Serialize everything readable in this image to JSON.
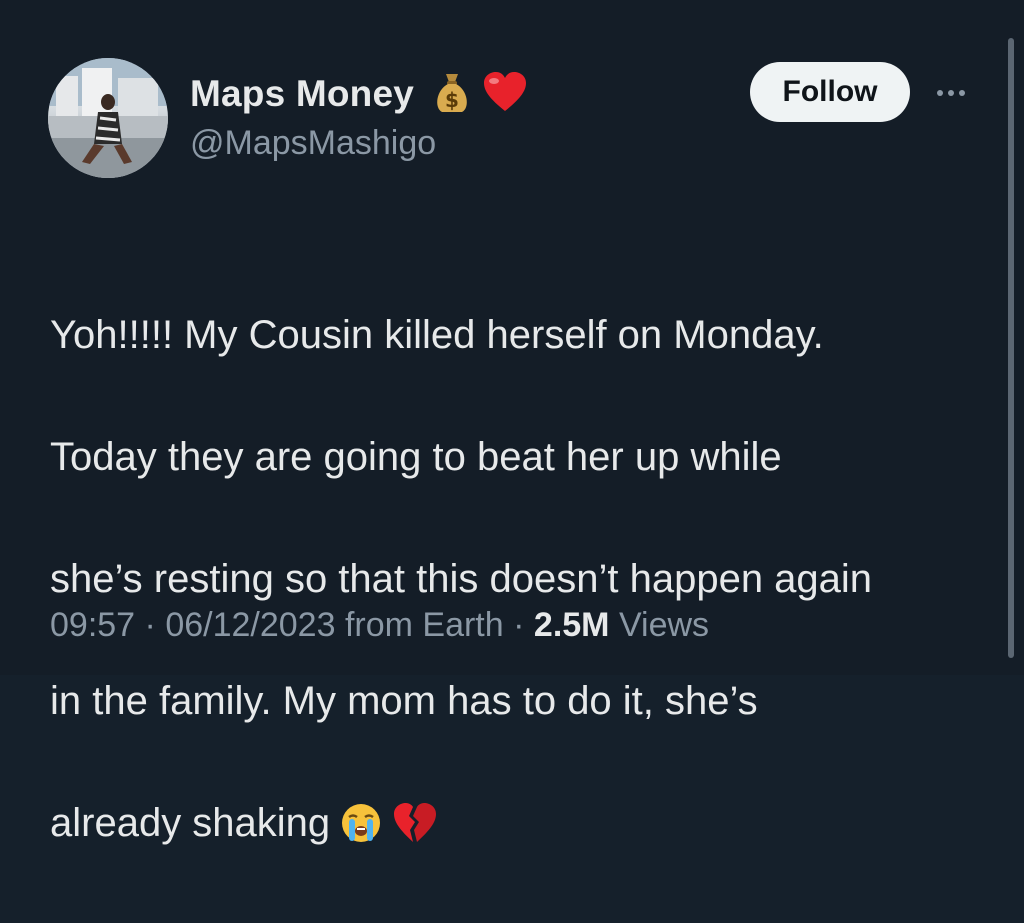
{
  "author": {
    "display_name": "Maps Money",
    "handle": "@MapsMashigo",
    "name_emojis": [
      "money-bag-icon",
      "red-heart-icon"
    ]
  },
  "actions": {
    "follow_label": "Follow",
    "more_icon": "more-horizontal-icon"
  },
  "tweet": {
    "lines": [
      "Yoh!!!!! My Cousin killed herself on Monday.",
      "Today they are going to beat her up while",
      "she’s resting so that this doesn’t happen again",
      "in the family. My mom has to do it, she’s",
      "already shaking"
    ],
    "trailing_emojis": [
      "loudly-crying-face-icon",
      "broken-heart-icon"
    ]
  },
  "meta": {
    "time": "09:57",
    "date": "06/12/2023",
    "source": "from Earth",
    "separator": "·",
    "views_count": "2.5M",
    "views_label": "Views"
  },
  "colors": {
    "background": "#141d27",
    "text": "#e7e9ea",
    "secondary_text": "#8b98a5",
    "follow_button_bg": "#eff3f4"
  }
}
